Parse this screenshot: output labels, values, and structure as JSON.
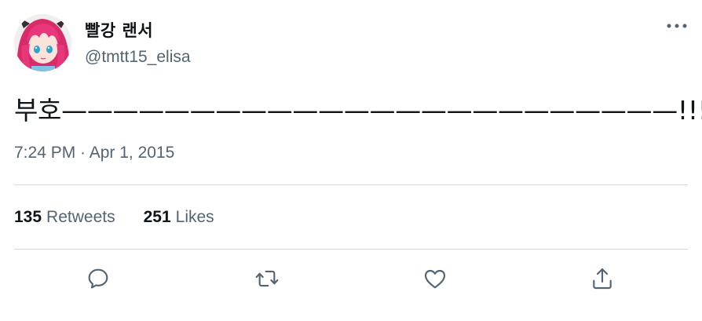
{
  "author": {
    "display_name": "빨강 랜서",
    "handle": "@tmtt15_elisa",
    "avatar_icon": "avatar-anime-character"
  },
  "tweet": {
    "text": "부호————————————————————————!!!!?",
    "timestamp": "7:24 PM · Apr 1, 2015"
  },
  "stats": {
    "retweets_count": "135",
    "retweets_label": "Retweets",
    "likes_count": "251",
    "likes_label": "Likes"
  },
  "actions": [
    {
      "icon": "reply-icon"
    },
    {
      "icon": "retweet-icon"
    },
    {
      "icon": "like-icon"
    },
    {
      "icon": "share-icon"
    }
  ],
  "colors": {
    "text_primary": "#0f1419",
    "text_secondary": "#536471",
    "divider": "#cfd9de",
    "avatar_hair": "#e0306a"
  }
}
